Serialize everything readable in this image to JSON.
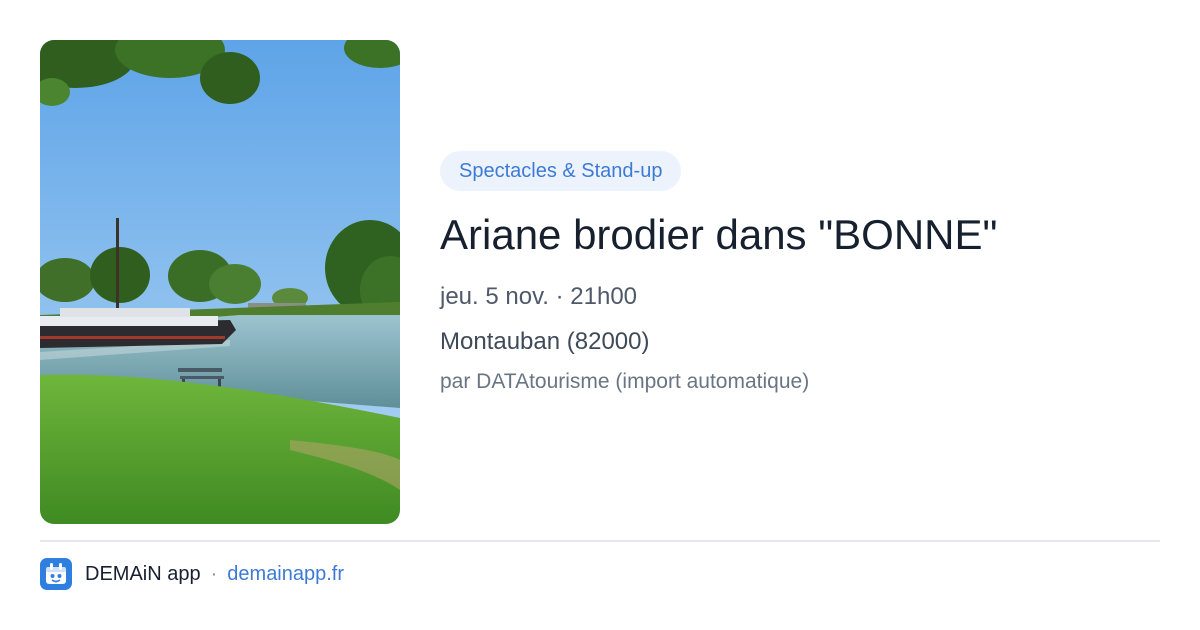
{
  "event": {
    "category_tag": "Spectacles & Stand-up",
    "title": "Ariane brodier dans \"BONNE\"",
    "datetime": "jeu. 5 nov. · 21h00",
    "location": "Montauban (82000)",
    "organizer": "par DATAtourisme (import automatique)"
  },
  "photo": {
    "icon": "canal-landscape-photo"
  },
  "footer": {
    "app_name": "DEMAiN app",
    "separator": "·",
    "url": "demainapp.fr",
    "app_icon": "demain-app-icon"
  },
  "colors": {
    "accent": "#3d7ad6",
    "tag_background": "#edf3fc",
    "title": "#17202e",
    "text_secondary": "#4e5969",
    "text_muted": "#6a7584",
    "divider": "#e5e9ef"
  }
}
